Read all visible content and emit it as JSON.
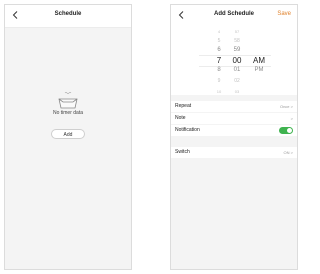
{
  "left_screen": {
    "title": "Schedule",
    "empty_text": "No timer data",
    "add_label": "Add"
  },
  "right_screen": {
    "title": "Add Schedule",
    "save_label": "Save",
    "picker": {
      "hours": [
        "4",
        "5",
        "6",
        "7",
        "8",
        "9",
        "10"
      ],
      "minutes": [
        "57",
        "58",
        "59",
        "00",
        "01",
        "02",
        "03"
      ],
      "ampm": [
        "AM",
        "PM"
      ],
      "selected": {
        "hour": "7",
        "minute": "00",
        "ampm": "AM"
      }
    },
    "settings": [
      {
        "label": "Repeat",
        "value": "Once"
      },
      {
        "label": "Note",
        "value": ""
      },
      {
        "label": "Notification",
        "value": ""
      },
      {
        "label": "Switch",
        "value": "ON"
      }
    ],
    "notification_enabled": true
  },
  "colors": {
    "accent": "#e0822c",
    "toggle_on": "#3fb34f"
  },
  "icons": [
    "chevron-left-icon",
    "empty-box-icon",
    "chevron-right-icon"
  ]
}
